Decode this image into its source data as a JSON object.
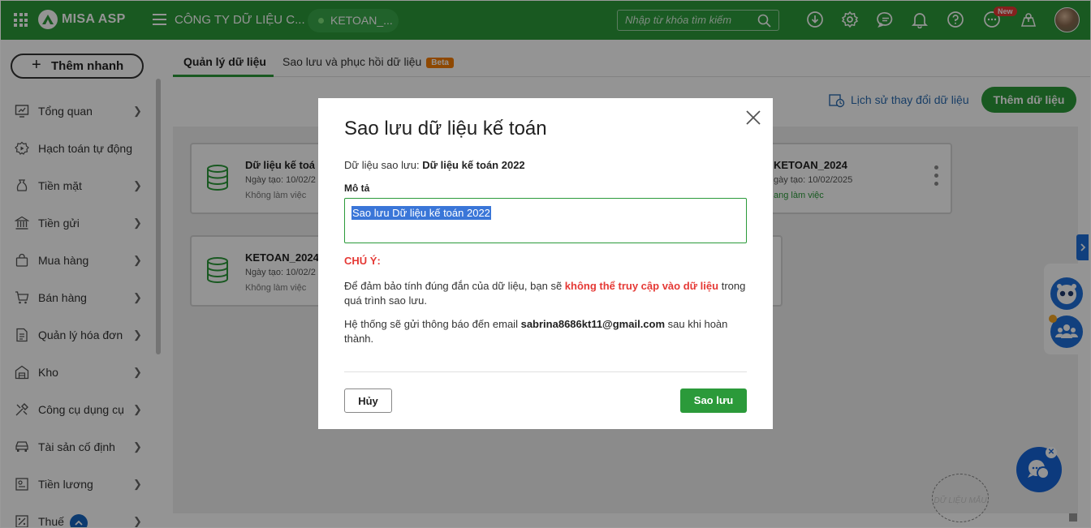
{
  "app": {
    "brand": "MISA ASP",
    "company": "CÔNG TY DỮ LIỆU C...",
    "database": "KETOAN_...",
    "search_placeholder": "Nhập từ khóa tìm kiếm",
    "new_badge": "New",
    "icons": [
      "apps-grid-icon",
      "download-icon",
      "gear-icon",
      "chat-bubble-icon",
      "bell-icon",
      "help-icon",
      "more-icon",
      "location-icon"
    ]
  },
  "sidebar": {
    "quick_add": "Thêm nhanh",
    "items": [
      {
        "label": "Tổng quan",
        "icon": "monitor-icon",
        "chevron": true
      },
      {
        "label": "Hạch toán tự động",
        "icon": "auto-icon",
        "chevron": false
      },
      {
        "label": "Tiền mặt",
        "icon": "money-bag-icon",
        "chevron": true
      },
      {
        "label": "Tiền gửi",
        "icon": "bank-icon",
        "chevron": true
      },
      {
        "label": "Mua hàng",
        "icon": "shopping-bag-icon",
        "chevron": true
      },
      {
        "label": "Bán hàng",
        "icon": "cart-icon",
        "chevron": true
      },
      {
        "label": "Quản lý hóa đơn",
        "icon": "invoice-icon",
        "chevron": true
      },
      {
        "label": "Kho",
        "icon": "warehouse-icon",
        "chevron": true
      },
      {
        "label": "Công cụ dụng cụ",
        "icon": "tools-icon",
        "chevron": true
      },
      {
        "label": "Tài sản cố định",
        "icon": "car-icon",
        "chevron": true
      },
      {
        "label": "Tiền lương",
        "icon": "payroll-icon",
        "chevron": true
      },
      {
        "label": "Thuế",
        "icon": "tax-icon",
        "chevron": true
      }
    ]
  },
  "tabs": [
    {
      "label": "Quản lý dữ liệu",
      "active": true
    },
    {
      "label": "Sao lưu và phục hồi dữ liệu",
      "badge": "Beta",
      "active": false
    }
  ],
  "toolbar": {
    "history_link": "Lịch sử thay đổi dữ liệu",
    "add_data": "Thêm dữ liệu"
  },
  "cards": [
    {
      "name": "Dữ liệu kế toá",
      "created": "Ngày tạo: 10/02/2",
      "status": "Không làm việc",
      "active": false
    },
    {
      "name": "KETOAN_2024",
      "created": "gày tạo: 10/02/2025",
      "status": "ang làm việc",
      "active": true
    },
    {
      "name": "KETOAN_2024",
      "created": "Ngày tạo: 10/02/2",
      "status": "Không làm việc",
      "active": false
    }
  ],
  "modal": {
    "title": "Sao lưu dữ liệu kế toán",
    "source_label": "Dữ liệu sao lưu:",
    "source_value": "Dữ liệu kế toán 2022",
    "desc_label": "Mô tả",
    "desc_value": "Sao lưu Dữ liệu kế toán 2022",
    "note_title": "CHÚ Ý:",
    "note1_pre": "Để đảm bảo tính đúng đắn của dữ liệu, bạn sẽ",
    "note1_warn": "không thể truy cập vào dữ liệu",
    "note1_post": "trong quá trình sao lưu.",
    "note2_pre": "Hệ thống sẽ gửi thông báo đến email",
    "note2_email": "sabrina8686kt11@gmail.com",
    "note2_post": "sau khi hoàn thành.",
    "cancel": "Hủy",
    "save": "Sao lưu"
  },
  "watermark": "DỮ LIỆU MẪU",
  "colors": {
    "brand_green": "#2b9a3a",
    "warning_red": "#e53935",
    "link_blue": "#2b6cb0",
    "beta_orange": "#f57c00"
  }
}
